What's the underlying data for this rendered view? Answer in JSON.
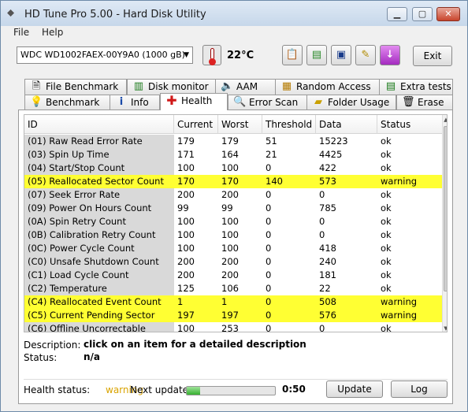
{
  "window": {
    "title": "HD Tune Pro 5.00 - Hard Disk Utility"
  },
  "menu": [
    "File",
    "Help"
  ],
  "toolbar": {
    "drive": "WDC WD1002FAEX-00Y9A0 (1000 gB)",
    "temperature": "22°C",
    "exit_label": "Exit"
  },
  "tabs_top": [
    "File Benchmark",
    "Disk monitor",
    "AAM",
    "Random Access",
    "Extra tests"
  ],
  "tabs_bottom": [
    "Benchmark",
    "Info",
    "Health",
    "Error Scan",
    "Folder Usage",
    "Erase"
  ],
  "active_tab": "Health",
  "table": {
    "columns": [
      "ID",
      "Current",
      "Worst",
      "Threshold",
      "Data",
      "Status"
    ],
    "rows": [
      {
        "id": "(01) Raw Read Error Rate",
        "current": "179",
        "worst": "179",
        "threshold": "51",
        "data": "15223",
        "status": "ok"
      },
      {
        "id": "(03) Spin Up Time",
        "current": "171",
        "worst": "164",
        "threshold": "21",
        "data": "4425",
        "status": "ok"
      },
      {
        "id": "(04) Start/Stop Count",
        "current": "100",
        "worst": "100",
        "threshold": "0",
        "data": "422",
        "status": "ok"
      },
      {
        "id": "(05) Reallocated Sector Count",
        "current": "170",
        "worst": "170",
        "threshold": "140",
        "data": "573",
        "status": "warning"
      },
      {
        "id": "(07) Seek Error Rate",
        "current": "200",
        "worst": "200",
        "threshold": "0",
        "data": "0",
        "status": "ok"
      },
      {
        "id": "(09) Power On Hours Count",
        "current": "99",
        "worst": "99",
        "threshold": "0",
        "data": "785",
        "status": "ok"
      },
      {
        "id": "(0A) Spin Retry Count",
        "current": "100",
        "worst": "100",
        "threshold": "0",
        "data": "0",
        "status": "ok"
      },
      {
        "id": "(0B) Calibration Retry Count",
        "current": "100",
        "worst": "100",
        "threshold": "0",
        "data": "0",
        "status": "ok"
      },
      {
        "id": "(0C) Power Cycle Count",
        "current": "100",
        "worst": "100",
        "threshold": "0",
        "data": "418",
        "status": "ok"
      },
      {
        "id": "(C0) Unsafe Shutdown Count",
        "current": "200",
        "worst": "200",
        "threshold": "0",
        "data": "240",
        "status": "ok"
      },
      {
        "id": "(C1) Load Cycle Count",
        "current": "200",
        "worst": "200",
        "threshold": "0",
        "data": "181",
        "status": "ok"
      },
      {
        "id": "(C2) Temperature",
        "current": "125",
        "worst": "106",
        "threshold": "0",
        "data": "22",
        "status": "ok"
      },
      {
        "id": "(C4) Reallocated Event Count",
        "current": "1",
        "worst": "1",
        "threshold": "0",
        "data": "508",
        "status": "warning"
      },
      {
        "id": "(C5) Current Pending Sector",
        "current": "197",
        "worst": "197",
        "threshold": "0",
        "data": "576",
        "status": "warning"
      },
      {
        "id": "(C6) Offline Uncorrectable",
        "current": "100",
        "worst": "253",
        "threshold": "0",
        "data": "0",
        "status": "ok"
      }
    ]
  },
  "details": {
    "description_label": "Description:",
    "description_value": "click on an item for a detailed description",
    "status_label": "Status:",
    "status_value": "n/a"
  },
  "footer": {
    "health_label": "Health status:",
    "health_value": "warning",
    "next_update_label": "Next update:",
    "progress_fraction": 0.15,
    "countdown": "0:50",
    "update_label": "Update",
    "log_label": "Log"
  },
  "colors": {
    "warning_row": "#ffff33",
    "health_warning_text": "#d9a300"
  },
  "icons": {
    "tabs_top": [
      "file-benchmark-icon",
      "disk-monitor-icon",
      "aam-speaker-icon",
      "random-access-icon",
      "extra-tests-icon"
    ],
    "tabs_bottom": [
      "benchmark-icon",
      "info-icon",
      "health-cross-icon",
      "error-scan-icon",
      "folder-usage-icon",
      "erase-icon"
    ]
  }
}
